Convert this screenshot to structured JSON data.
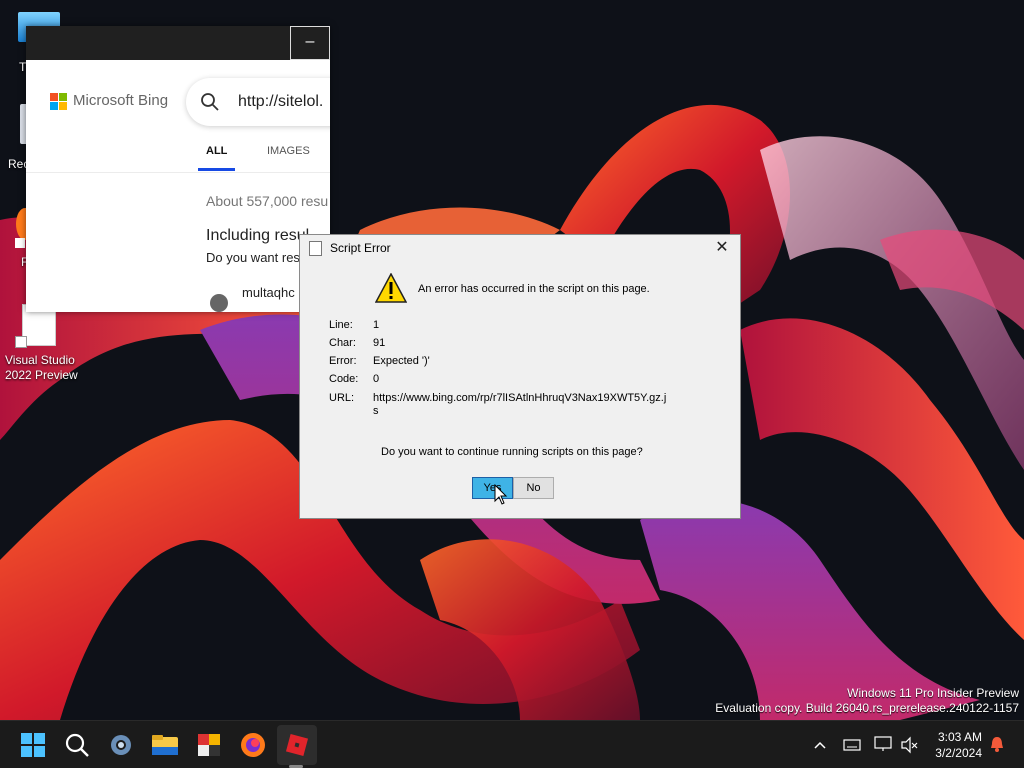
{
  "desktop": {
    "icons": [
      {
        "label": "T"
      },
      {
        "label": "Rec"
      },
      {
        "label": "F"
      },
      {
        "label_line1": "Visual Studio",
        "label_line2": "2022 Preview"
      }
    ]
  },
  "browser": {
    "minimize_glyph": "–",
    "brand": "Microsoft Bing",
    "search_value": "http://sitelol.",
    "tabs": [
      {
        "label": "ALL"
      },
      {
        "label": "IMAGES"
      }
    ],
    "results_count": "About 557,000 resu",
    "including": "Including resul",
    "do_you_want": "Do you want res",
    "result_title": "multaqhc"
  },
  "dialog": {
    "title": "Script Error",
    "message": "An error has occurred in the script on this page.",
    "fields": [
      {
        "label": "Line:",
        "value": "1"
      },
      {
        "label": "Char:",
        "value": "91"
      },
      {
        "label": "Error:",
        "value": "Expected ')'"
      },
      {
        "label": "Code:",
        "value": "0"
      },
      {
        "label": "URL:",
        "value": "https://www.bing.com/rp/r7lISAtlnHhruqV3Nax19XWT5Y.gz.j",
        "value_line2": "s"
      }
    ],
    "question": "Do you want to continue running scripts on this page?",
    "yes_label": "Yes",
    "no_label": "No"
  },
  "watermark": {
    "line1": "Windows 11 Pro Insider Preview",
    "line2": "Evaluation copy. Build 26040.rs_prerelease.240122-1157"
  },
  "taskbar": {
    "apps": [
      "start-icon",
      "search-icon",
      "settings-icon",
      "file-explorer-icon",
      "app-icon",
      "firefox-icon",
      "roblox-icon"
    ],
    "time": "3:03 AM",
    "date": "3/2/2024"
  },
  "colors": {
    "dialog_bg": "#f0f0f0",
    "yes_button": "#3fb3e6",
    "bing_tab_underline": "#174ae4",
    "taskbar": "#1b1b1b"
  }
}
